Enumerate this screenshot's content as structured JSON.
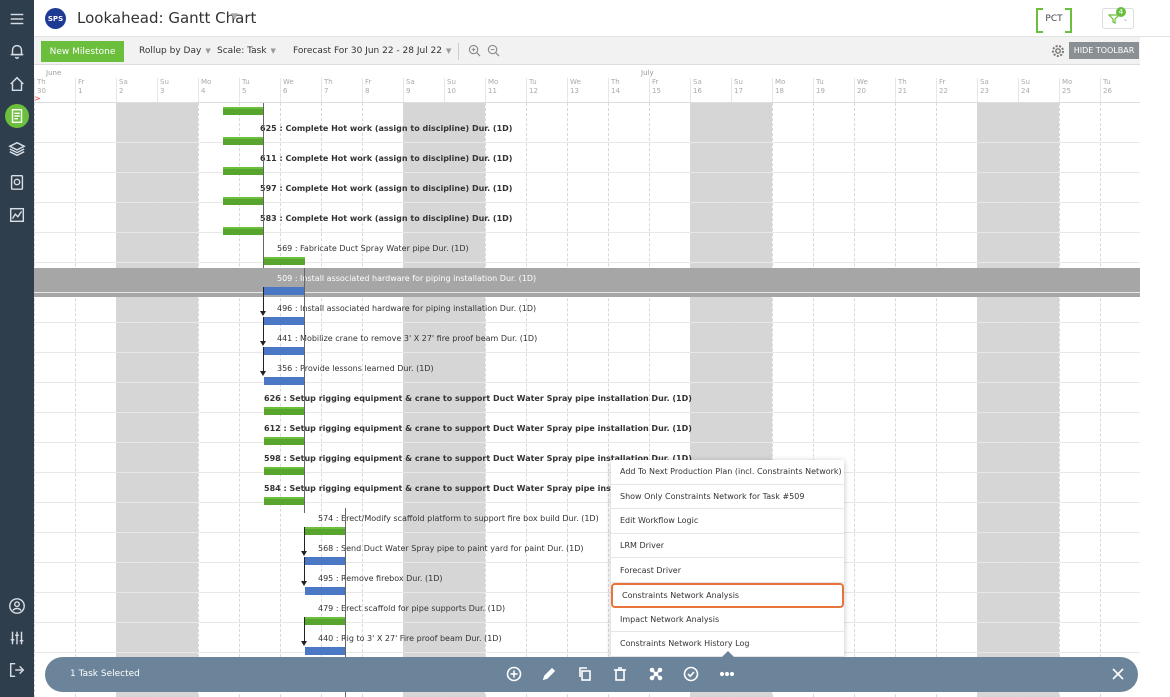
{
  "header": {
    "logo_text": "SPS",
    "title": "Lookahead: Gantt Chart",
    "pct_label": "PCT",
    "filter_count": "4"
  },
  "toolbar": {
    "new_milestone": "New Milestone",
    "rollup": "Rollup by Day",
    "scale": "Scale: Task",
    "forecast": "Forecast For 30 Jun 22 - 28 Jul 22",
    "hide_toolbar": "HIDE TOOLBAR"
  },
  "timeline": {
    "months": [
      "June",
      "July"
    ],
    "days": [
      {
        "dow": "Th",
        "num": "30"
      },
      {
        "dow": "Fr",
        "num": "1"
      },
      {
        "dow": "Sa",
        "num": "2"
      },
      {
        "dow": "Su",
        "num": "3"
      },
      {
        "dow": "Mo",
        "num": "4"
      },
      {
        "dow": "Tu",
        "num": "5"
      },
      {
        "dow": "We",
        "num": "6"
      },
      {
        "dow": "Th",
        "num": "7"
      },
      {
        "dow": "Fr",
        "num": "8"
      },
      {
        "dow": "Sa",
        "num": "9"
      },
      {
        "dow": "Su",
        "num": "10"
      },
      {
        "dow": "Mo",
        "num": "11"
      },
      {
        "dow": "Tu",
        "num": "12"
      },
      {
        "dow": "We",
        "num": "13"
      },
      {
        "dow": "Th",
        "num": "14"
      },
      {
        "dow": "Fr",
        "num": "15"
      },
      {
        "dow": "Sa",
        "num": "16"
      },
      {
        "dow": "Su",
        "num": "17"
      },
      {
        "dow": "Mo",
        "num": "18"
      },
      {
        "dow": "Tu",
        "num": "19"
      },
      {
        "dow": "We",
        "num": "20"
      },
      {
        "dow": "Th",
        "num": "21"
      },
      {
        "dow": "Fr",
        "num": "22"
      },
      {
        "dow": "Sa",
        "num": "23"
      },
      {
        "dow": "Su",
        "num": "24"
      },
      {
        "dow": "Mo",
        "num": "25"
      },
      {
        "dow": "Tu",
        "num": "26"
      }
    ]
  },
  "tasks": [
    {
      "label": "625 : Complete Hot work (assign to discipline) Dur. (1D)",
      "bold": true,
      "selected": false,
      "color": "green"
    },
    {
      "label": "611 : Complete Hot work (assign to discipline) Dur. (1D)",
      "bold": true,
      "selected": false,
      "color": "green"
    },
    {
      "label": "597 : Complete Hot work (assign to discipline) Dur. (1D)",
      "bold": true,
      "selected": false,
      "color": "green"
    },
    {
      "label": "583 : Complete Hot work (assign to discipline) Dur. (1D)",
      "bold": true,
      "selected": false,
      "color": "green"
    },
    {
      "label": "569 : Fabricate Duct Spray Water pipe Dur. (1D)",
      "bold": false,
      "selected": false,
      "color": "green"
    },
    {
      "label": "509 : Install associated hardware for piping installation Dur. (1D)",
      "bold": false,
      "selected": true,
      "color": "blue"
    },
    {
      "label": "496 : Install associated hardware for piping installation Dur. (1D)",
      "bold": false,
      "selected": false,
      "color": "blue"
    },
    {
      "label": "441 : Mobilize crane to remove 3' X 27' fire proof beam Dur. (1D)",
      "bold": false,
      "selected": false,
      "color": "blue"
    },
    {
      "label": "356 : Provide lessons learned Dur. (1D)",
      "bold": false,
      "selected": false,
      "color": "blue"
    },
    {
      "label": "626 : Setup rigging equipment & crane to support Duct Water Spray pipe installation Dur. (1D)",
      "bold": true,
      "selected": false,
      "color": "green"
    },
    {
      "label": "612 : Setup rigging equipment & crane to support Duct Water Spray pipe installation Dur. (1D)",
      "bold": true,
      "selected": false,
      "color": "green"
    },
    {
      "label": "598 : Setup rigging equipment & crane to support Duct Water Spray pipe installation Dur. (1D)",
      "bold": true,
      "selected": false,
      "color": "green"
    },
    {
      "label": "584 : Setup rigging equipment & crane to support Duct Water Spray pipe installation Dur. (1D)",
      "bold": true,
      "selected": false,
      "color": "green"
    },
    {
      "label": "574 : Erect/Modify scaffold platform to support fire box build Dur. (1D)",
      "bold": false,
      "selected": false,
      "color": "green"
    },
    {
      "label": "568 : Send Duct Water Spray pipe to paint yard for paint Dur. (1D)",
      "bold": false,
      "selected": false,
      "color": "blue"
    },
    {
      "label": "495 : Remove firebox Dur. (1D)",
      "bold": false,
      "selected": false,
      "color": "blue"
    },
    {
      "label": "479 : Erect scaffold for pipe supports Dur. (1D)",
      "bold": false,
      "selected": false,
      "color": "green"
    },
    {
      "label": "440 : Rig to 3' X 27' Fire proof beam Dur. (1D)",
      "bold": false,
      "selected": false,
      "color": "blue"
    }
  ],
  "context_menu": {
    "items": [
      "Add To Next Production Plan (incl. Constraints Network)",
      "Show Only Constraints Network for Task #509",
      "Edit Workflow Logic",
      "LRM Driver",
      "Forecast Driver",
      "Constraints Network Analysis",
      "Impact Network Analysis",
      "Constraints Network History Log"
    ],
    "highlighted_index": 5
  },
  "action_bar": {
    "selected_text": "1 Task Selected",
    "icons": [
      "add-icon",
      "edit-icon",
      "copy-icon",
      "delete-icon",
      "network-icon",
      "check-icon",
      "more-icon"
    ]
  },
  "colors": {
    "sidebar": "#2f3e4d",
    "accent_green": "#6bbf3d",
    "bar_green": "#58a52e",
    "bar_blue": "#4a78c4",
    "highlight_orange": "#e8743b",
    "action_bar": "#6b849a"
  }
}
